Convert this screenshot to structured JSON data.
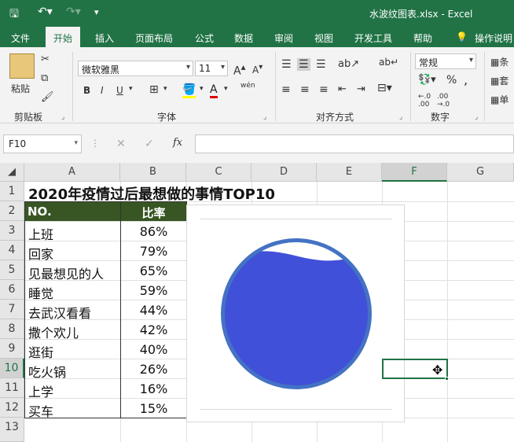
{
  "window": {
    "title": "水波纹图表.xlsx  -  Excel"
  },
  "tabs": [
    "文件",
    "开始",
    "插入",
    "页面布局",
    "公式",
    "数据",
    "审阅",
    "视图",
    "开发工具",
    "帮助",
    "操作说明"
  ],
  "ribbon": {
    "clipboard": {
      "label": "剪贴板",
      "paste": "粘贴"
    },
    "font": {
      "label": "字体",
      "name": "微软雅黑",
      "size": "11",
      "bold": "B",
      "italic": "I",
      "underline": "U",
      "phonetic": "wén"
    },
    "alignment": {
      "label": "对齐方式"
    },
    "number": {
      "label": "数字",
      "format": "常规",
      "percent": "%",
      "comma": ","
    },
    "styles": [
      "条",
      "套",
      "单"
    ]
  },
  "formula_bar": {
    "cell_ref": "F10",
    "fx": "fx",
    "value": ""
  },
  "columns": [
    "A",
    "B",
    "C",
    "D",
    "E",
    "F",
    "G"
  ],
  "rows": [
    "1",
    "2",
    "3",
    "4",
    "5",
    "6",
    "7",
    "8",
    "9",
    "10",
    "11",
    "12",
    "13"
  ],
  "sheet": {
    "title": "2020年疫情过后最想做的事情TOP10",
    "header": {
      "no": "NO.",
      "ratio": "比率"
    },
    "items": [
      {
        "name": "上班",
        "pct": "86%"
      },
      {
        "name": "回家",
        "pct": "79%"
      },
      {
        "name": "见最想见的人",
        "pct": "65%"
      },
      {
        "name": "睡觉",
        "pct": "59%"
      },
      {
        "name": "去武汉看看",
        "pct": "44%"
      },
      {
        "name": "撒个欢儿",
        "pct": "42%"
      },
      {
        "name": "逛街",
        "pct": "40%"
      },
      {
        "name": "吃火锅",
        "pct": "26%"
      },
      {
        "name": "上学",
        "pct": "16%"
      },
      {
        "name": "买车",
        "pct": "15%"
      }
    ]
  },
  "chart": {
    "fill_level": 0.9,
    "colors": {
      "fill": "#4050d8",
      "ring": "#4472c4"
    }
  },
  "colors": {
    "brand": "#217346",
    "header_fill": "#375623"
  }
}
